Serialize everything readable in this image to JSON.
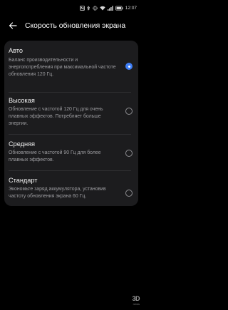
{
  "status_bar": {
    "time": "12:07",
    "icons": [
      "nfc-icon",
      "bluetooth-icon",
      "vibrate-icon",
      "wifi-icon",
      "signal-icon",
      "battery-icon"
    ]
  },
  "header": {
    "back_icon": "arrow-left-icon",
    "title": "Скорость обновления экрана"
  },
  "options": [
    {
      "title": "Авто",
      "description": "Баланс производительности и энергопотребления при максимальной частоте обновления 120 Гц.",
      "selected": true
    },
    {
      "title": "Высокая",
      "description": "Обновление с частотой 120 Гц для очень плавных эффектов. Потребляет больше энергии.",
      "selected": false
    },
    {
      "title": "Средняя",
      "description": "Обновление с частотой 90 Гц для более плавных эффектов.",
      "selected": false
    },
    {
      "title": "Стандарт",
      "description": "Экономьте заряд аккумулятора, установив частоту обновления экрана 60 Гц.",
      "selected": false
    }
  ],
  "watermark": {
    "main": "3D",
    "sub": "news"
  },
  "colors": {
    "background": "#000000",
    "card": "#1c1c1e",
    "accent": "#3f7ff7",
    "secondary_text": "#9d9da1"
  }
}
